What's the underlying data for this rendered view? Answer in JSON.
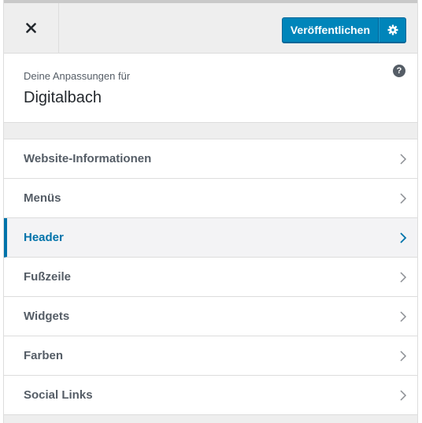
{
  "header": {
    "close_label": "Close",
    "publish_label": "Veröffentlichen",
    "settings_label": "Publish settings"
  },
  "info": {
    "label": "Deine Anpassungen für",
    "site_title": "Digitalbach",
    "help_symbol": "?"
  },
  "menu": {
    "items": [
      {
        "label": "Website-Informationen"
      },
      {
        "label": "Menüs"
      },
      {
        "label": "Header"
      },
      {
        "label": "Fußzeile"
      },
      {
        "label": "Widgets"
      },
      {
        "label": "Farben"
      },
      {
        "label": "Social Links"
      }
    ]
  },
  "colors": {
    "accent": "#0085ba",
    "active_text": "#0073aa",
    "panel_bg": "#eeeeee"
  }
}
